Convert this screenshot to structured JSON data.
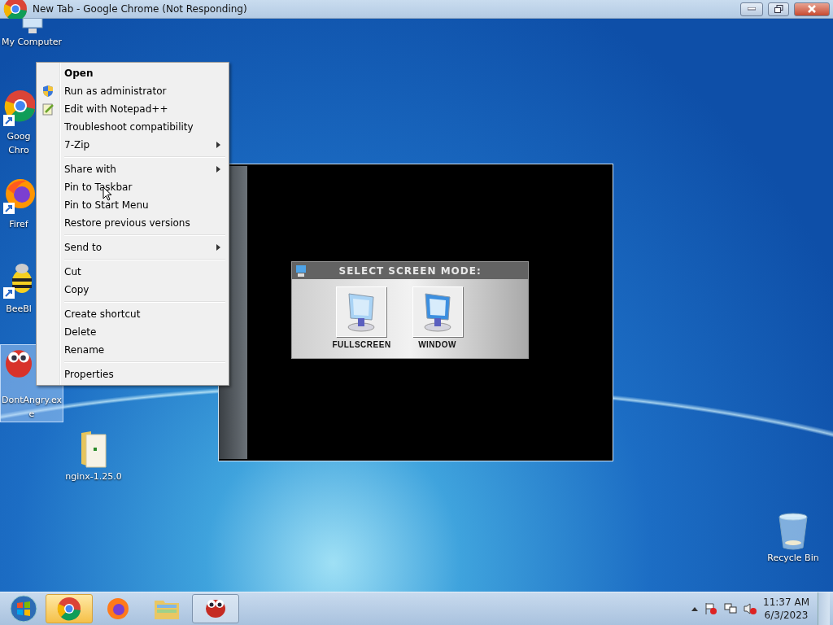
{
  "window": {
    "title": "New Tab - Google Chrome (Not Responding)"
  },
  "desktop_icons": [
    {
      "kind": "computer",
      "lines": [
        "My Computer"
      ],
      "selected": false
    },
    {
      "kind": "chrome",
      "lines": [
        "Goog",
        "Chro"
      ],
      "selected": false
    },
    {
      "kind": "firefox",
      "lines": [
        "Firef"
      ],
      "selected": false
    },
    {
      "kind": "bee",
      "lines": [
        "BeeBl"
      ],
      "selected": false
    },
    {
      "kind": "game",
      "lines": [
        "DontAngry.ex",
        "e"
      ],
      "selected": true
    },
    {
      "kind": "folder",
      "lines": [
        "nginx-1.25.0"
      ],
      "selected": false
    },
    {
      "kind": "recycle",
      "lines": [
        "Recycle Bin"
      ],
      "selected": false
    }
  ],
  "context_menu": [
    {
      "kind": "plain",
      "label": "Open",
      "default": true,
      "submenu": false
    },
    {
      "kind": "admin",
      "label": "Run as administrator",
      "default": false,
      "submenu": false
    },
    {
      "kind": "edit",
      "label": "Edit with Notepad++",
      "default": false,
      "submenu": false
    },
    {
      "kind": "plain",
      "label": "Troubleshoot compatibility",
      "default": false,
      "submenu": false
    },
    {
      "kind": "plain",
      "label": "7-Zip",
      "default": false,
      "submenu": true
    },
    {
      "kind": "separator"
    },
    {
      "kind": "plain",
      "label": "Share with",
      "default": false,
      "submenu": true
    },
    {
      "kind": "plain",
      "label": "Pin to Taskbar",
      "default": false,
      "submenu": false
    },
    {
      "kind": "plain",
      "label": "Pin to Start Menu",
      "default": false,
      "submenu": false
    },
    {
      "kind": "plain",
      "label": "Restore previous versions",
      "default": false,
      "submenu": false
    },
    {
      "kind": "separator"
    },
    {
      "kind": "plain",
      "label": "Send to",
      "default": false,
      "submenu": true
    },
    {
      "kind": "separator"
    },
    {
      "kind": "plain",
      "label": "Cut",
      "default": false,
      "submenu": false
    },
    {
      "kind": "plain",
      "label": "Copy",
      "default": false,
      "submenu": false
    },
    {
      "kind": "separator"
    },
    {
      "kind": "plain",
      "label": "Create shortcut",
      "default": false,
      "submenu": false
    },
    {
      "kind": "plain",
      "label": "Delete",
      "default": false,
      "submenu": false
    },
    {
      "kind": "plain",
      "label": "Rename",
      "default": false,
      "submenu": false
    },
    {
      "kind": "separator"
    },
    {
      "kind": "plain",
      "label": "Properties",
      "default": false,
      "submenu": false
    }
  ],
  "game_window": {
    "dialog_title": "SELECT SCREEN MODE:",
    "options": [
      {
        "kind": "fullscreen",
        "label": "FULLSCREEN"
      },
      {
        "kind": "window",
        "label": "WINDOW"
      }
    ]
  },
  "taskbar": {
    "apps": [
      {
        "kind": "chrome",
        "attention": true,
        "open": true
      },
      {
        "kind": "firefox",
        "attention": false,
        "open": false
      },
      {
        "kind": "explorer",
        "attention": false,
        "open": false
      },
      {
        "kind": "game",
        "attention": false,
        "open": true
      }
    ],
    "tray": {
      "time": "11:37 AM",
      "date": "6/3/2023"
    }
  }
}
